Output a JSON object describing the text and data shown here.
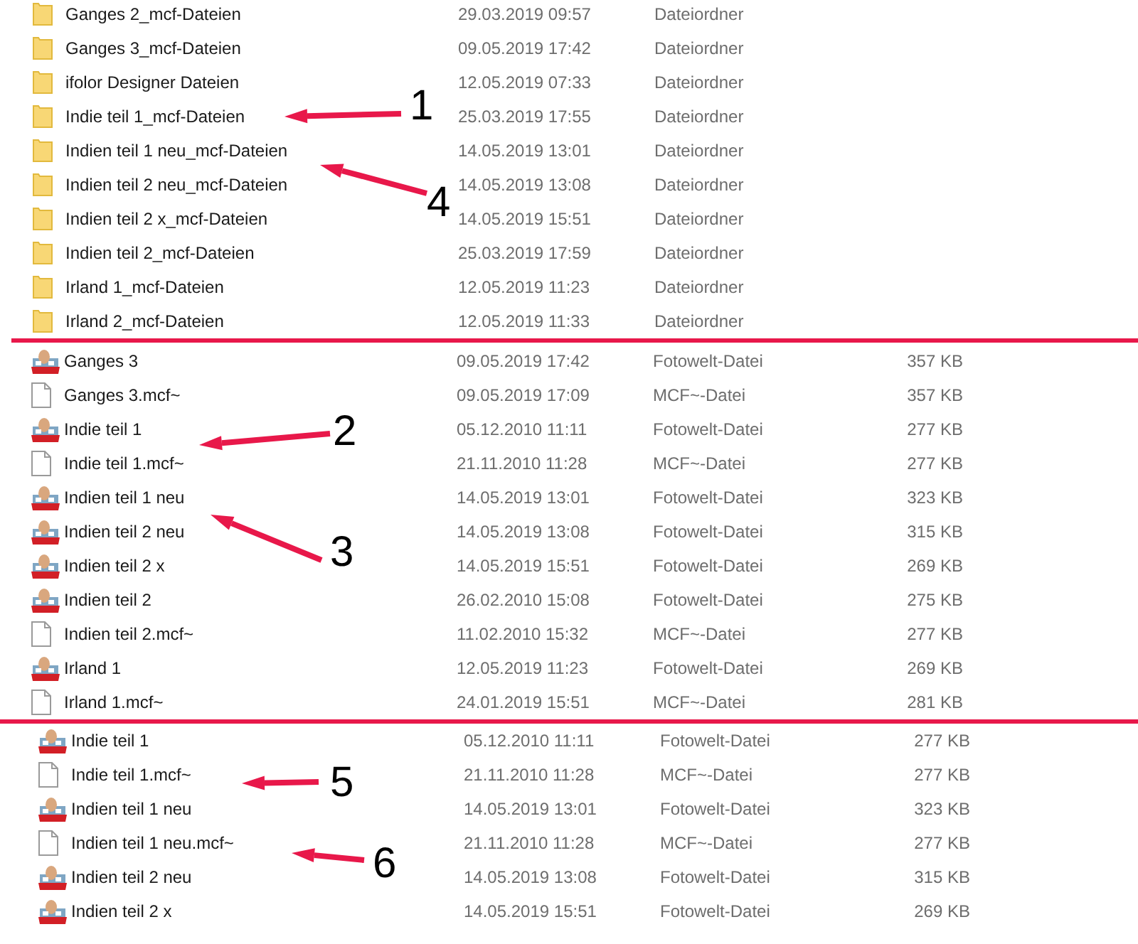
{
  "sections": [
    {
      "rows": [
        {
          "kind": "folder",
          "name": "Ganges 2_mcf-Dateien",
          "date": "29.03.2019 09:57",
          "type": "Dateiordner"
        },
        {
          "kind": "folder",
          "name": "Ganges 3_mcf-Dateien",
          "date": "09.05.2019 17:42",
          "type": "Dateiordner"
        },
        {
          "kind": "folder",
          "name": "ifolor Designer Dateien",
          "date": "12.05.2019 07:33",
          "type": "Dateiordner"
        },
        {
          "kind": "folder",
          "name": "Indie teil 1_mcf-Dateien",
          "date": "25.03.2019 17:55",
          "type": "Dateiordner"
        },
        {
          "kind": "folder",
          "name": "Indien teil 1 neu_mcf-Dateien",
          "date": "14.05.2019 13:01",
          "type": "Dateiordner"
        },
        {
          "kind": "folder",
          "name": "Indien teil 2 neu_mcf-Dateien",
          "date": "14.05.2019 13:08",
          "type": "Dateiordner"
        },
        {
          "kind": "folder",
          "name": "Indien teil 2 x_mcf-Dateien",
          "date": "14.05.2019 15:51",
          "type": "Dateiordner"
        },
        {
          "kind": "folder",
          "name": "Indien teil 2_mcf-Dateien",
          "date": "25.03.2019 17:59",
          "type": "Dateiordner"
        },
        {
          "kind": "folder",
          "name": "Irland 1_mcf-Dateien",
          "date": "12.05.2019 11:23",
          "type": "Dateiordner"
        },
        {
          "kind": "folder",
          "name": "Irland 2_mcf-Dateien",
          "date": "12.05.2019 11:33",
          "type": "Dateiordner"
        }
      ]
    },
    {
      "rows": [
        {
          "kind": "fotowelt",
          "name": "Ganges 3",
          "date": "09.05.2019 17:42",
          "type": "Fotowelt-Datei",
          "size": "357 KB"
        },
        {
          "kind": "mcf",
          "name": "Ganges 3.mcf~",
          "date": "09.05.2019 17:09",
          "type": "MCF~-Datei",
          "size": "357 KB"
        },
        {
          "kind": "fotowelt",
          "name": "Indie teil 1",
          "date": "05.12.2010 11:11",
          "type": "Fotowelt-Datei",
          "size": "277 KB"
        },
        {
          "kind": "mcf",
          "name": "Indie teil 1.mcf~",
          "date": "21.11.2010 11:28",
          "type": "MCF~-Datei",
          "size": "277 KB"
        },
        {
          "kind": "fotowelt",
          "name": "Indien teil 1 neu",
          "date": "14.05.2019 13:01",
          "type": "Fotowelt-Datei",
          "size": "323 KB"
        },
        {
          "kind": "fotowelt",
          "name": "Indien teil 2 neu",
          "date": "14.05.2019 13:08",
          "type": "Fotowelt-Datei",
          "size": "315 KB"
        },
        {
          "kind": "fotowelt",
          "name": "Indien teil 2 x",
          "date": "14.05.2019 15:51",
          "type": "Fotowelt-Datei",
          "size": "269 KB"
        },
        {
          "kind": "fotowelt",
          "name": "Indien teil 2",
          "date": "26.02.2010 15:08",
          "type": "Fotowelt-Datei",
          "size": "275 KB"
        },
        {
          "kind": "mcf",
          "name": "Indien teil 2.mcf~",
          "date": "11.02.2010 15:32",
          "type": "MCF~-Datei",
          "size": "277 KB"
        },
        {
          "kind": "fotowelt",
          "name": "Irland 1",
          "date": "12.05.2019 11:23",
          "type": "Fotowelt-Datei",
          "size": "269 KB"
        },
        {
          "kind": "mcf",
          "name": "Irland 1.mcf~",
          "date": "24.01.2019 15:51",
          "type": "MCF~-Datei",
          "size": "281 KB"
        }
      ]
    },
    {
      "rows": [
        {
          "kind": "fotowelt",
          "name": "Indie teil 1",
          "date": "05.12.2010 11:11",
          "type": "Fotowelt-Datei",
          "size": "277 KB"
        },
        {
          "kind": "mcf",
          "name": "Indie teil 1.mcf~",
          "date": "21.11.2010 11:28",
          "type": "MCF~-Datei",
          "size": "277 KB"
        },
        {
          "kind": "fotowelt",
          "name": "Indien teil 1 neu",
          "date": "14.05.2019 13:01",
          "type": "Fotowelt-Datei",
          "size": "323 KB"
        },
        {
          "kind": "mcf",
          "name": "Indien teil 1 neu.mcf~",
          "date": "21.11.2010 11:28",
          "type": "MCF~-Datei",
          "size": "277 KB"
        },
        {
          "kind": "fotowelt",
          "name": "Indien teil 2 neu",
          "date": "14.05.2019 13:08",
          "type": "Fotowelt-Datei",
          "size": "315 KB"
        },
        {
          "kind": "fotowelt",
          "name": "Indien teil 2 x",
          "date": "14.05.2019 15:51",
          "type": "Fotowelt-Datei",
          "size": "269 KB"
        }
      ]
    }
  ],
  "annotations": [
    {
      "label": "1"
    },
    {
      "label": "4"
    },
    {
      "label": "2"
    },
    {
      "label": "3"
    },
    {
      "label": "5"
    },
    {
      "label": "6"
    }
  ]
}
